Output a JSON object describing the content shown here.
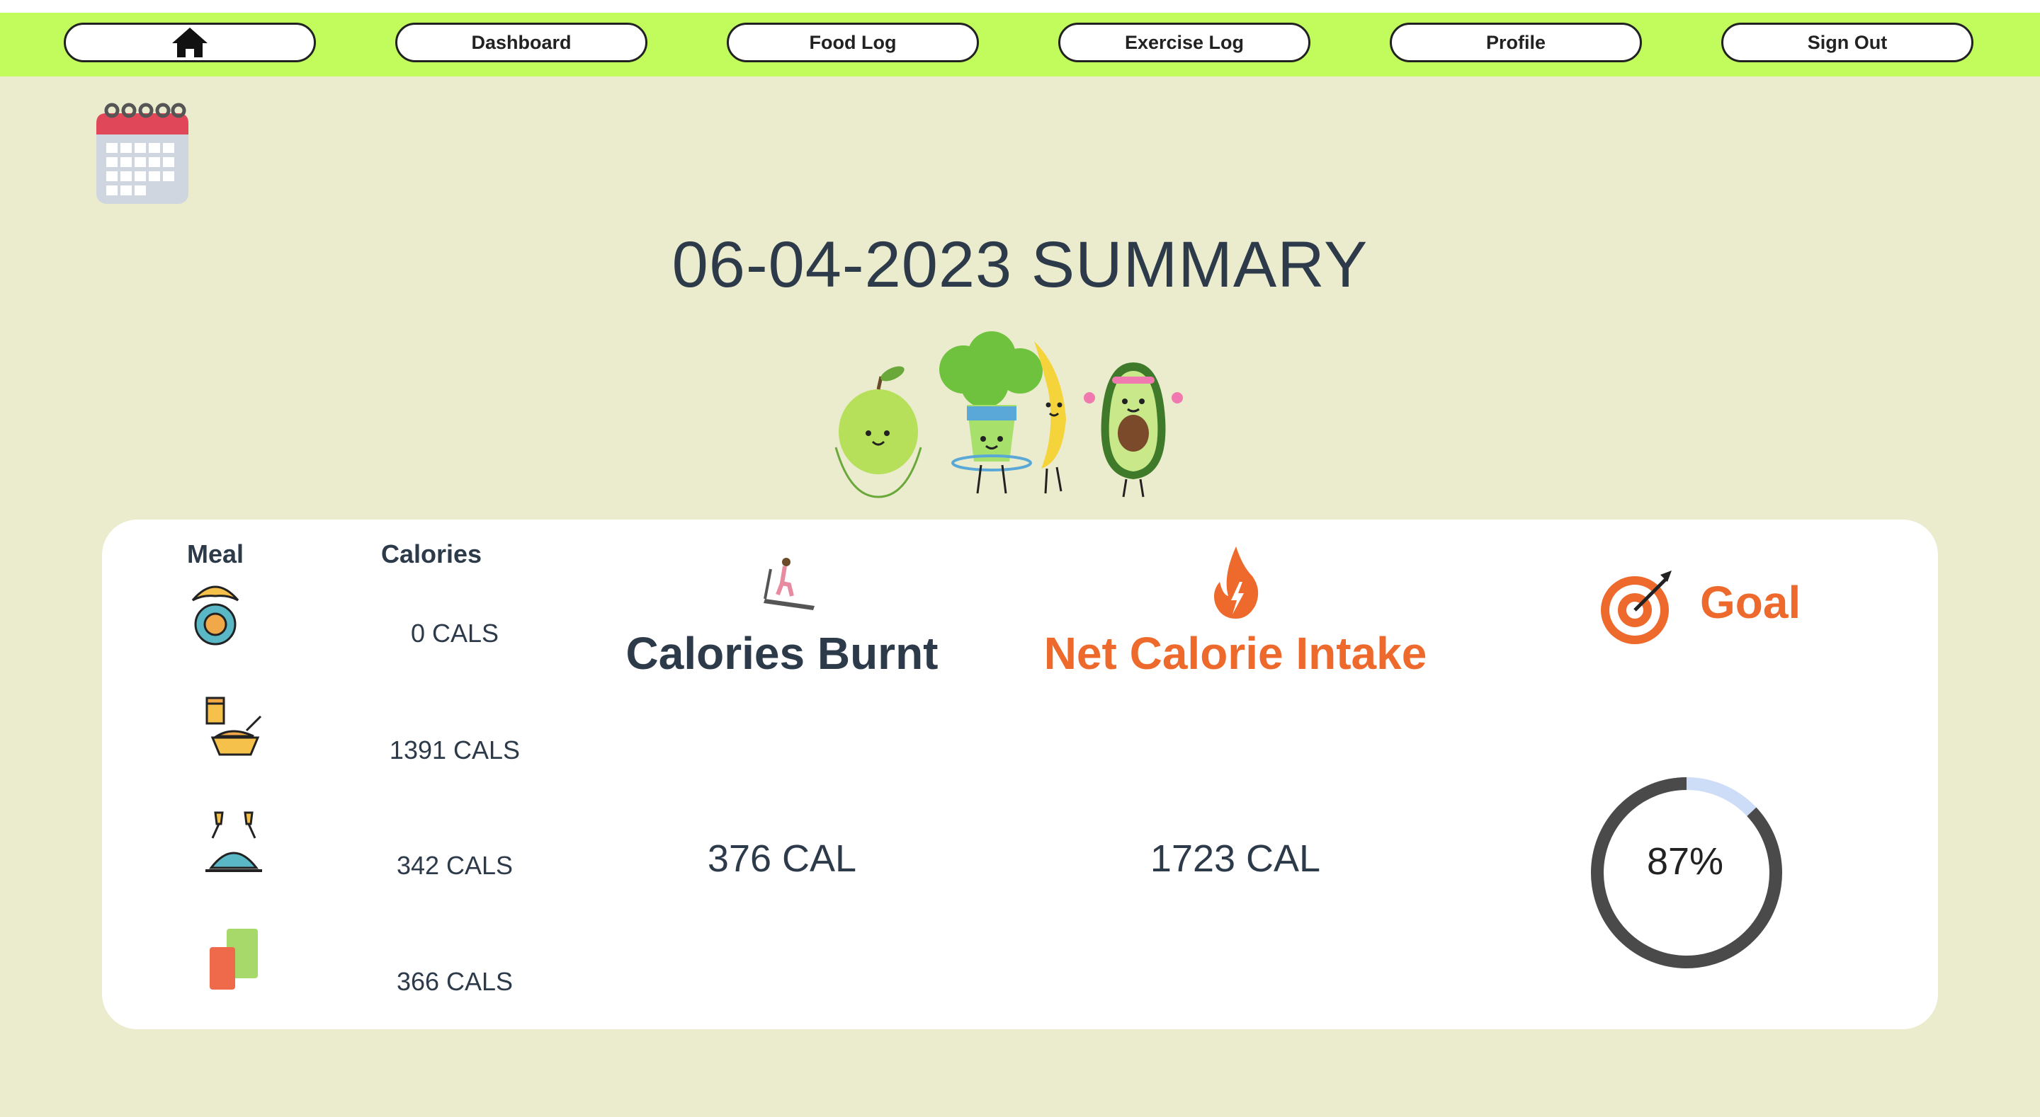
{
  "nav": {
    "home_icon": "home-icon",
    "items": [
      "Dashboard",
      "Food Log",
      "Exercise Log",
      "Profile",
      "Sign Out"
    ]
  },
  "calendar_icon": "calendar-icon",
  "summary": {
    "title": "06-04-2023 SUMMARY"
  },
  "meals": {
    "header_meal": "Meal",
    "header_calories": "Calories",
    "rows": [
      {
        "icon": "breakfast-icon",
        "calories": "0 CALS"
      },
      {
        "icon": "lunch-icon",
        "calories": "1391 CALS"
      },
      {
        "icon": "dinner-icon",
        "calories": "342 CALS"
      },
      {
        "icon": "snacks-icon",
        "calories": "366 CALS"
      }
    ]
  },
  "burnt": {
    "icon": "treadmill-icon",
    "label": "Calories Burnt",
    "value": "376 CAL"
  },
  "net": {
    "icon": "flame-icon",
    "label": "Net Calorie Intake",
    "value": "1723 CAL"
  },
  "goal": {
    "icon": "target-icon",
    "label": "Goal",
    "percent_text": "87%",
    "progress": 0.87
  },
  "colors": {
    "nav_bar": "#c2fb5c",
    "page_bg": "#ebebcd",
    "accent": "#ee6a2c",
    "ring": "#4a4a4a",
    "ring_remaining": "#cddcf7"
  }
}
